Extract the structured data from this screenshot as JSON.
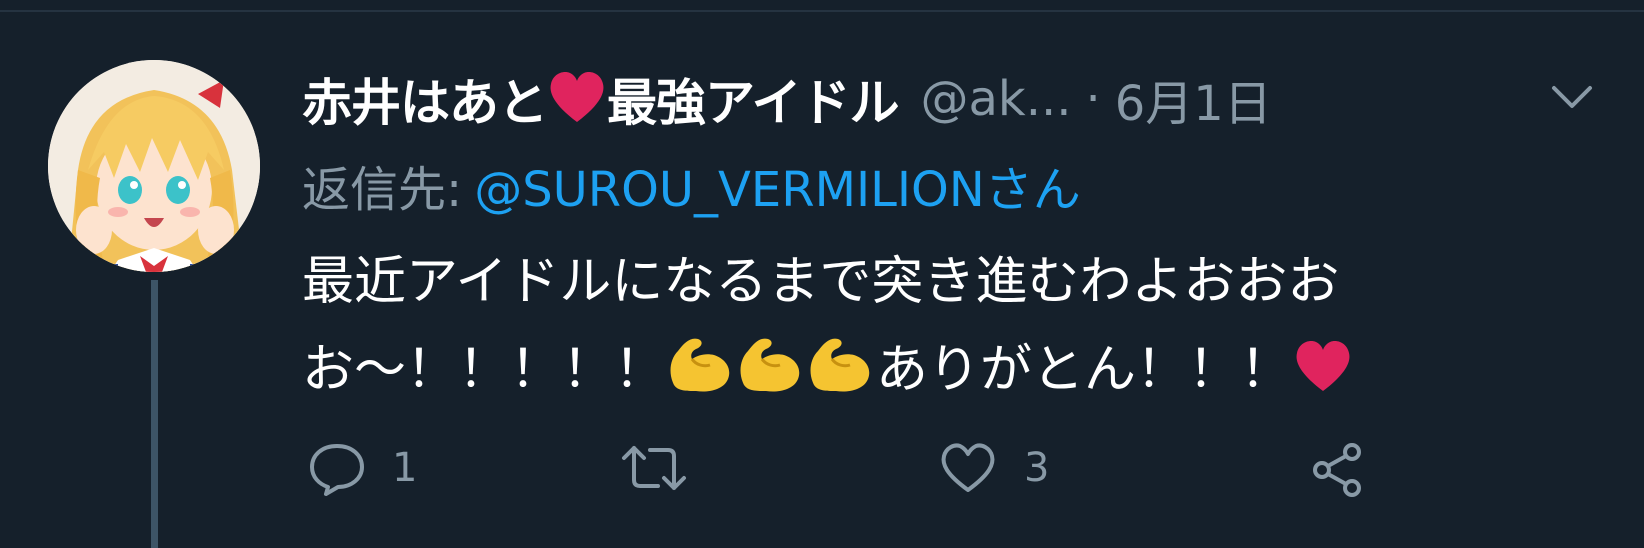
{
  "tweet": {
    "display_name": "赤井はあと",
    "display_name_suffix": "最強アイドル",
    "handle": "@ak...",
    "separator": "·",
    "date": "6月1日",
    "reply_prefix": "返信先:",
    "reply_target": "@SUROU_VERMILIONさん",
    "text_part1": "最近アイドルになるまで突き進むわよおおおお〜！！！！！",
    "text_part2": "ありがとん！！！",
    "emoji_flex_count": 3
  },
  "actions": {
    "reply_count": "1",
    "retweet_count": "",
    "like_count": "3"
  },
  "colors": {
    "background": "#15202b",
    "text_primary": "#ffffff",
    "text_secondary": "#8899a6",
    "link": "#1da1f2",
    "heart": "#e0245e",
    "thread_line": "#3d5466"
  },
  "icons": [
    "heart-icon",
    "chevron-down-icon",
    "reply-icon",
    "retweet-icon",
    "like-icon",
    "share-icon",
    "flexed-biceps-emoji"
  ]
}
